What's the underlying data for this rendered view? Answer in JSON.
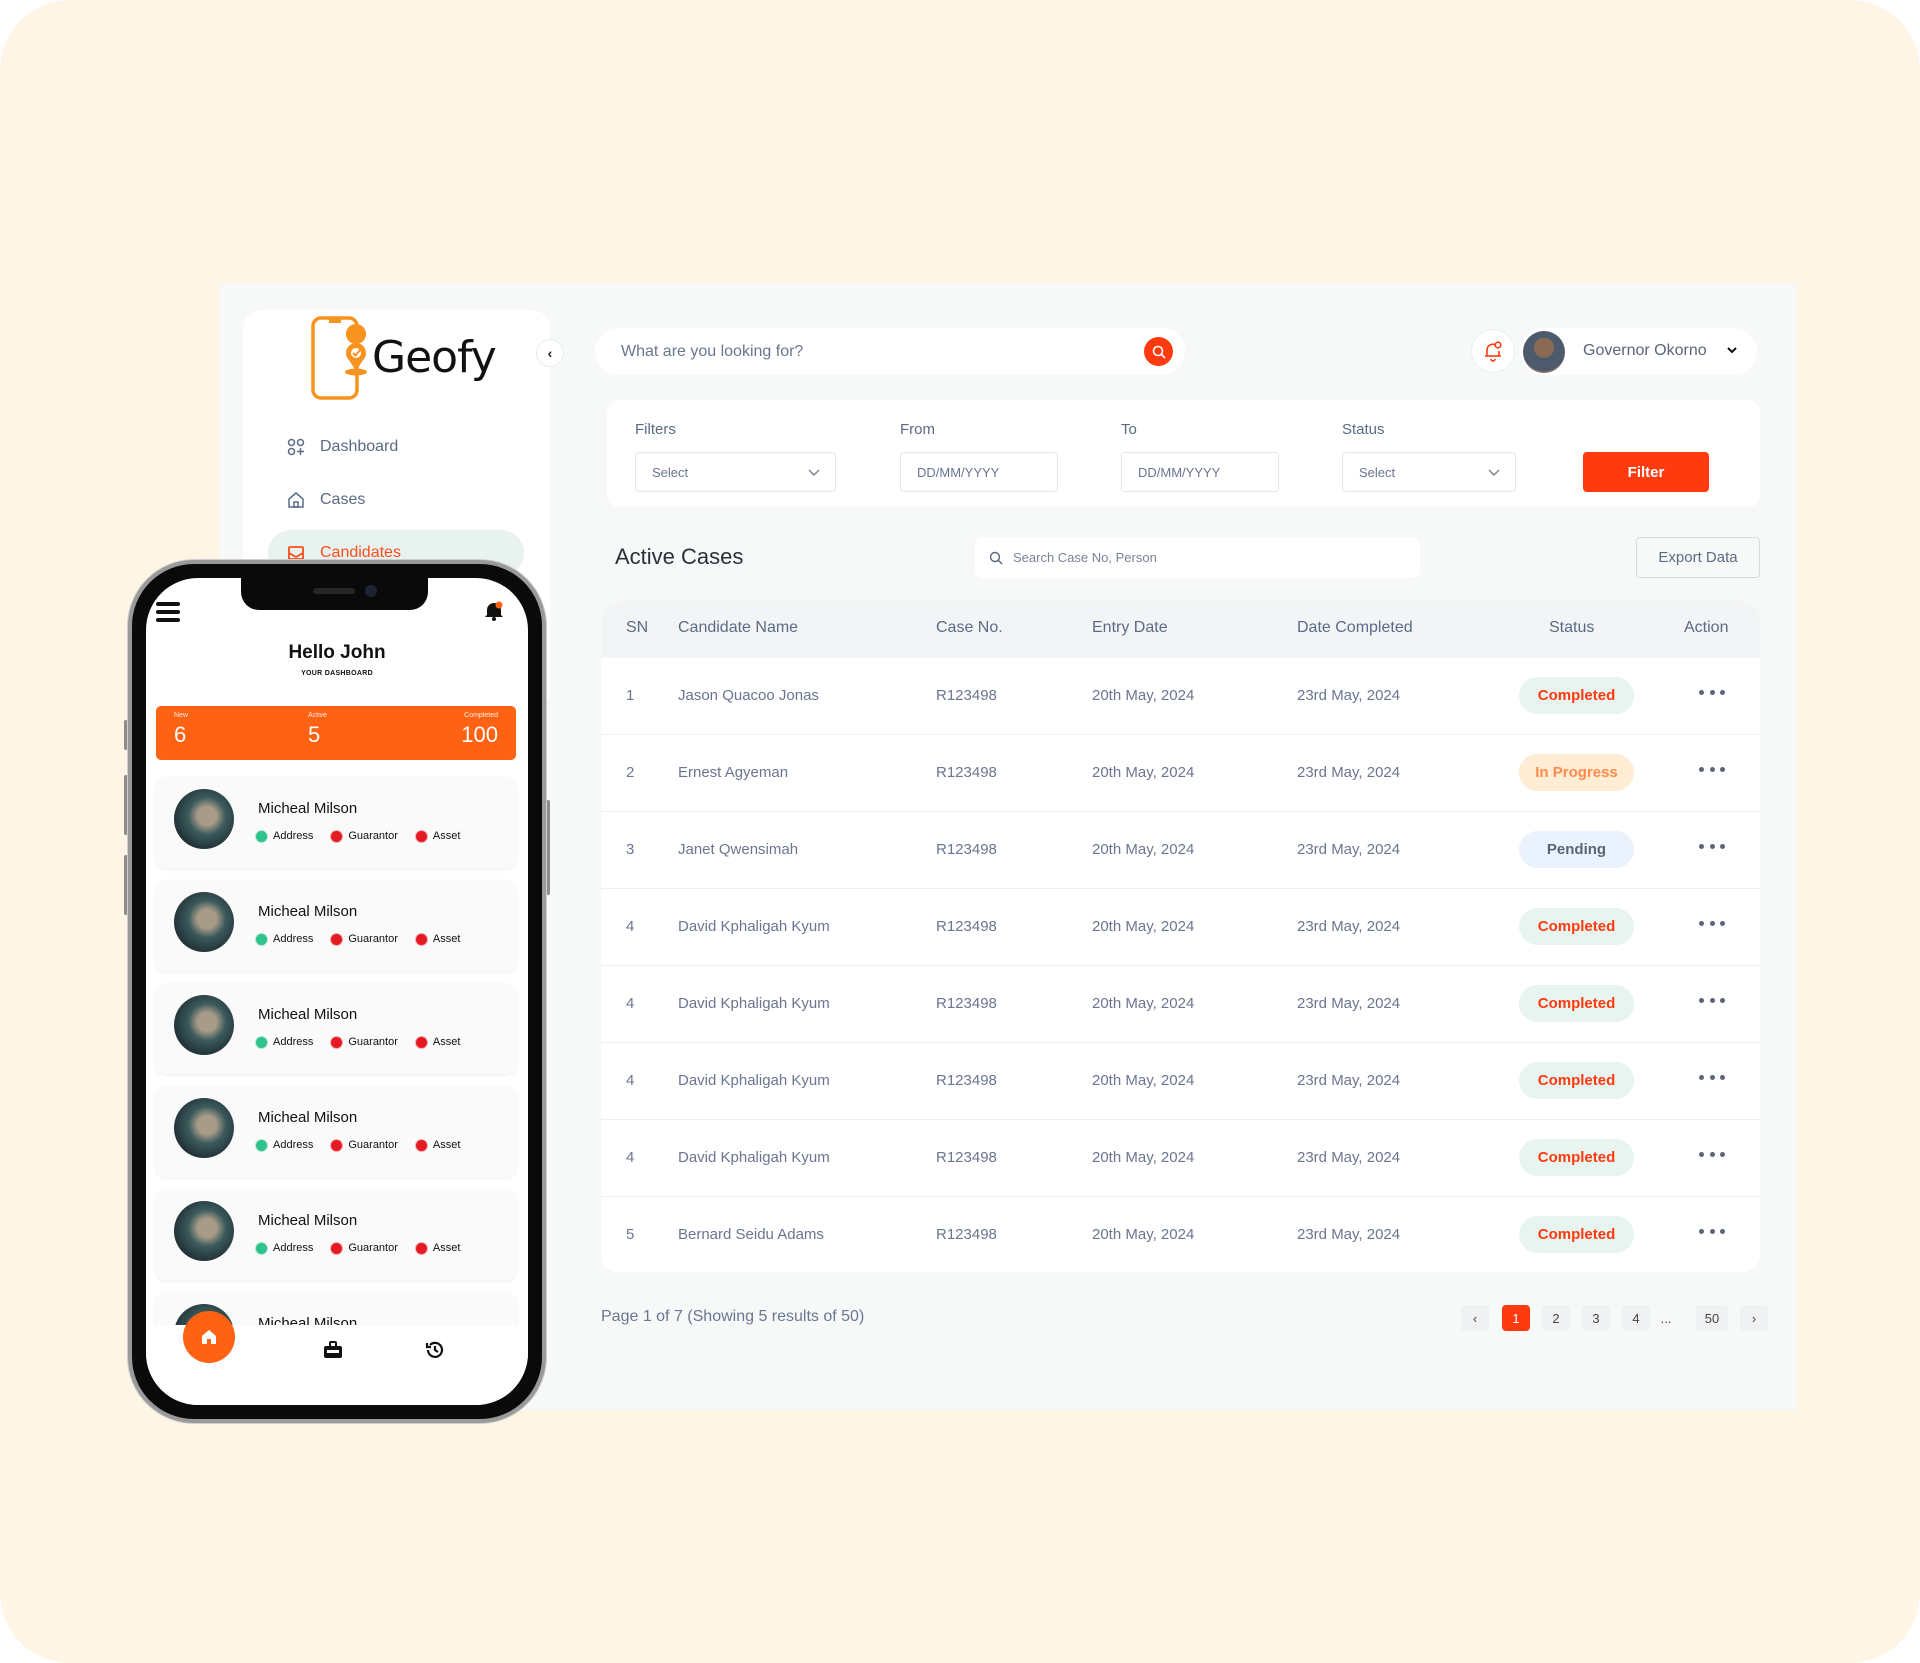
{
  "app": {
    "name": "Geofy"
  },
  "sidebar": {
    "items": [
      {
        "label": "Dashboard",
        "icon": "grid-plus-icon",
        "active": false
      },
      {
        "label": "Cases",
        "icon": "home-icon",
        "active": false
      },
      {
        "label": "Candidates",
        "icon": "inbox-icon",
        "active": true
      }
    ]
  },
  "topbar": {
    "search_placeholder": "What are you looking for?",
    "user_name": "Governor Okorno"
  },
  "filters": {
    "filters_label": "Filters",
    "filters_value": "Select",
    "from_label": "From",
    "from_placeholder": "DD/MM/YYYY",
    "to_label": "To",
    "to_placeholder": "DD/MM/YYYY",
    "status_label": "Status",
    "status_value": "Select",
    "filter_button": "Filter"
  },
  "cases": {
    "title": "Active Cases",
    "search_placeholder": "Search Case No, Person",
    "export_button": "Export Data",
    "columns": [
      "SN",
      "Candidate Name",
      "Case No.",
      "Entry Date",
      "Date Completed",
      "Status",
      "Action"
    ],
    "rows": [
      {
        "sn": "1",
        "name": "Jason Quacoo Jonas",
        "case_no": "R123498",
        "entry": "20th May, 2024",
        "completed": "23rd May, 2024",
        "status": "Completed"
      },
      {
        "sn": "2",
        "name": "Ernest Agyeman",
        "case_no": "R123498",
        "entry": "20th May, 2024",
        "completed": "23rd May, 2024",
        "status": "In Progress"
      },
      {
        "sn": "3",
        "name": "Janet Qwensimah",
        "case_no": "R123498",
        "entry": "20th May, 2024",
        "completed": "23rd May, 2024",
        "status": "Pending"
      },
      {
        "sn": "4",
        "name": "David Kphaligah Kyum",
        "case_no": "R123498",
        "entry": "20th May, 2024",
        "completed": "23rd May, 2024",
        "status": "Completed"
      },
      {
        "sn": "4",
        "name": "David Kphaligah Kyum",
        "case_no": "R123498",
        "entry": "20th May, 2024",
        "completed": "23rd May, 2024",
        "status": "Completed"
      },
      {
        "sn": "4",
        "name": "David Kphaligah Kyum",
        "case_no": "R123498",
        "entry": "20th May, 2024",
        "completed": "23rd May, 2024",
        "status": "Completed"
      },
      {
        "sn": "4",
        "name": "David Kphaligah Kyum",
        "case_no": "R123498",
        "entry": "20th May, 2024",
        "completed": "23rd May, 2024",
        "status": "Completed"
      },
      {
        "sn": "5",
        "name": "Bernard Seidu Adams",
        "case_no": "R123498",
        "entry": "20th May, 2024",
        "completed": "23rd May, 2024",
        "status": "Completed"
      }
    ],
    "status_colors": {
      "Completed": {
        "bg": "#e8f4ef",
        "fg": "#ff3a0f"
      },
      "In Progress": {
        "bg": "#ffecd4",
        "fg": "#ff8a4c"
      },
      "Pending": {
        "bg": "#eaf2fd",
        "fg": "#5b6478"
      }
    }
  },
  "pagination": {
    "info": "Page 1 of 7 (Showing 5 results of 50)",
    "prev": "‹",
    "next": "›",
    "pages": [
      "1",
      "2",
      "3",
      "4",
      "...",
      "50"
    ],
    "current": "1"
  },
  "phone": {
    "greeting": "Hello John",
    "subtitle": "YOUR DASHBOARD",
    "stats": [
      {
        "label": "New",
        "value": "6"
      },
      {
        "label": "Active",
        "value": "5"
      },
      {
        "label": "Completed",
        "value": "100"
      }
    ],
    "candidates": [
      {
        "name": "Micheal Milson",
        "tags": [
          {
            "label": "Address",
            "state": "ok"
          },
          {
            "label": "Guarantor",
            "state": "bad"
          },
          {
            "label": "Asset",
            "state": "bad"
          }
        ]
      },
      {
        "name": "Micheal Milson",
        "tags": [
          {
            "label": "Address",
            "state": "ok"
          },
          {
            "label": "Guarantor",
            "state": "bad"
          },
          {
            "label": "Asset",
            "state": "bad"
          }
        ]
      },
      {
        "name": "Micheal Milson",
        "tags": [
          {
            "label": "Address",
            "state": "ok"
          },
          {
            "label": "Guarantor",
            "state": "bad"
          },
          {
            "label": "Asset",
            "state": "bad"
          }
        ]
      },
      {
        "name": "Micheal Milson",
        "tags": [
          {
            "label": "Address",
            "state": "ok"
          },
          {
            "label": "Guarantor",
            "state": "bad"
          },
          {
            "label": "Asset",
            "state": "bad"
          }
        ]
      },
      {
        "name": "Micheal Milson",
        "tags": [
          {
            "label": "Address",
            "state": "ok"
          },
          {
            "label": "Guarantor",
            "state": "bad"
          },
          {
            "label": "Asset",
            "state": "bad"
          }
        ]
      },
      {
        "name": "Micheal Milson",
        "tags": []
      }
    ],
    "tag_colors": {
      "ok": "#2fc48d",
      "bad": "#e51b23"
    },
    "tabs": [
      {
        "icon": "home-icon"
      },
      {
        "icon": "briefcase-icon"
      },
      {
        "icon": "history-icon"
      }
    ]
  },
  "colors": {
    "accent": "#ff3a0f",
    "phone_accent": "#fe6212",
    "logo": "#f7931e"
  }
}
